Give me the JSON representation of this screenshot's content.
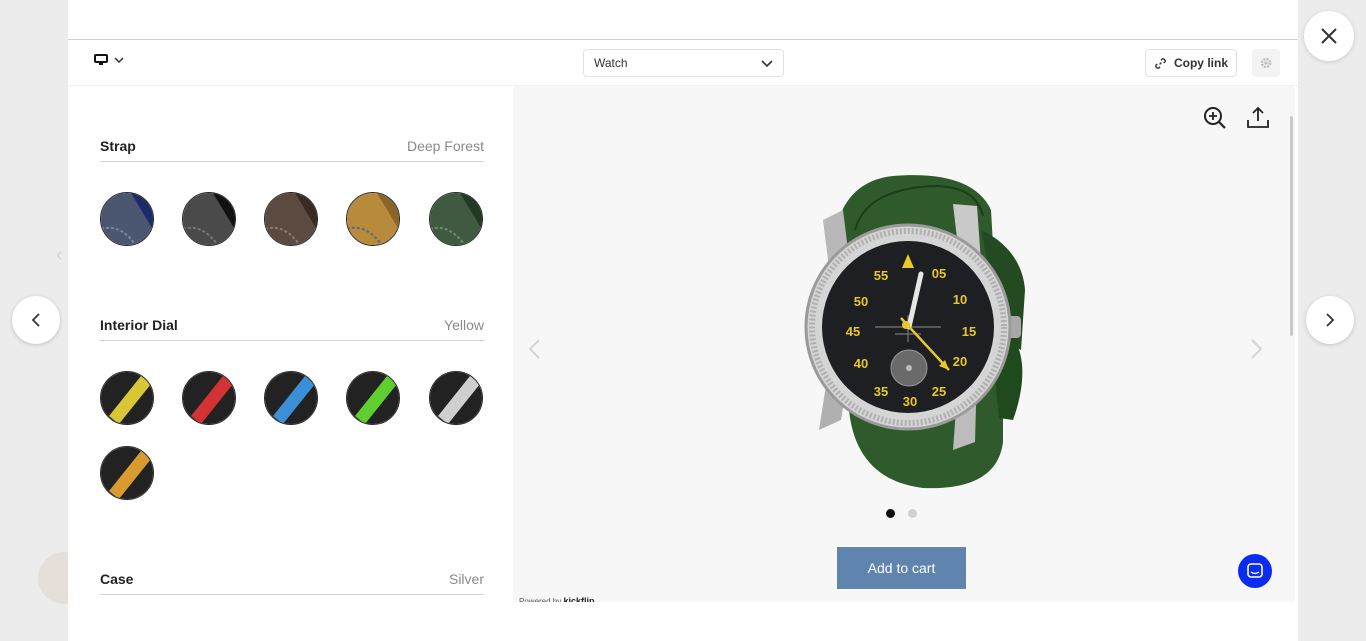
{
  "toolbar": {
    "device_icon": "desktop-monitor-icon",
    "product_select_value": "Watch",
    "copy_link_label": "Copy link",
    "settings_icon": "gear-icon"
  },
  "options": [
    {
      "title": "Strap",
      "selected": "Deep Forest",
      "swatches": [
        {
          "name": "strap-navy",
          "colors": [
            "#4b5670",
            "#1b2a6b"
          ]
        },
        {
          "name": "strap-black",
          "colors": [
            "#4a4a4a",
            "#111111"
          ]
        },
        {
          "name": "strap-brown",
          "colors": [
            "#5a4a40",
            "#3a2a22"
          ]
        },
        {
          "name": "strap-tan",
          "colors": [
            "#b88a3c",
            "#8a6528"
          ]
        },
        {
          "name": "strap-deep-forest",
          "colors": [
            "#3f5a40",
            "#223a24"
          ]
        }
      ]
    },
    {
      "title": "Interior Dial",
      "selected": "Yellow",
      "swatches": [
        {
          "name": "dial-yellow",
          "colors": [
            "#222222",
            "#d8c637"
          ]
        },
        {
          "name": "dial-red",
          "colors": [
            "#222222",
            "#d33333"
          ]
        },
        {
          "name": "dial-blue",
          "colors": [
            "#222222",
            "#3b8fd6"
          ]
        },
        {
          "name": "dial-green",
          "colors": [
            "#222222",
            "#5fcf2f"
          ]
        },
        {
          "name": "dial-silver",
          "colors": [
            "#222222",
            "#cfcfcf"
          ]
        },
        {
          "name": "dial-orange",
          "colors": [
            "#222222",
            "#d99a2f"
          ]
        }
      ]
    },
    {
      "title": "Case",
      "selected": "Silver",
      "swatches": []
    }
  ],
  "preview": {
    "zoom_icon": "zoom-in-icon",
    "share_icon": "share-upload-icon",
    "add_to_cart_label": "Add to cart",
    "powered_prefix": "Powered by",
    "powered_brand": "kickflip",
    "carousel_active_index": 1,
    "carousel_count": 2,
    "dial_numbers": [
      "55",
      "05",
      "50",
      "10",
      "45",
      "15",
      "40",
      "20",
      "35",
      "25",
      "30"
    ],
    "chat_icon": "chat-bubble-icon",
    "colors": {
      "strap": "#2f5a2c",
      "dial_text": "#e8c82a",
      "button": "#5f84ae",
      "chat": "#0a2cf0"
    }
  },
  "window": {
    "close_icon": "close-x-icon",
    "prev_icon": "chevron-left-icon",
    "next_icon": "chevron-right-icon"
  }
}
